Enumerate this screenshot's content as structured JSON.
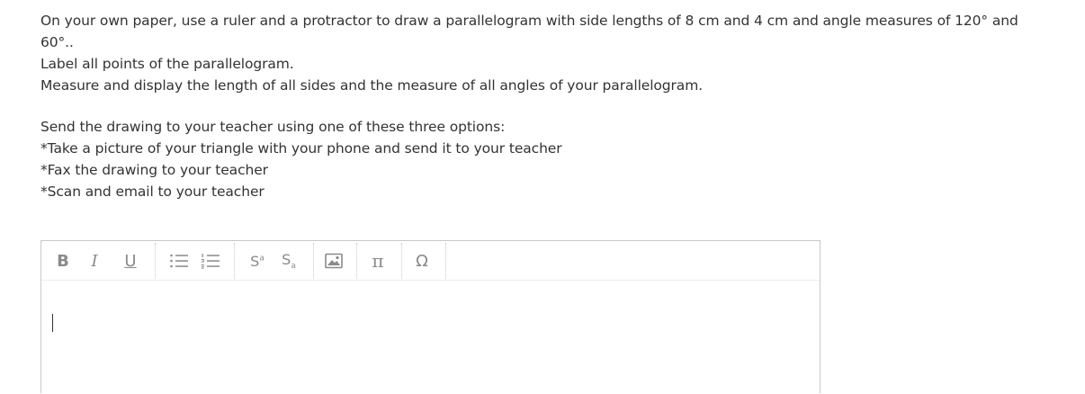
{
  "question": {
    "line1": "On your own paper, use a ruler and a protractor to draw a parallelogram with side lengths of 8 cm and 4 cm and angle measures of 120° and",
    "line1b": "60°..",
    "line2": "Label all points of the parallelogram.",
    "line3": "Measure and display the length of all sides and the measure of all angles of your parallelogram.",
    "line4": "Send the drawing to your teacher using one of these three options:",
    "line5": "*Take a picture of your triangle with your phone and send it to your teacher",
    "line6": "*Fax the drawing to your teacher",
    "line7": "*Scan and email to your teacher"
  },
  "toolbar": {
    "bold": "B",
    "italic": "I",
    "underline": "U",
    "superscript_base": "S",
    "superscript_mark": "a",
    "subscript_base": "S",
    "subscript_mark": "a",
    "pi": "π",
    "omega": "Ω",
    "icons": {
      "bullet_list": "bulleted-list-icon",
      "numbered_list": "numbered-list-icon",
      "image": "insert-image-icon"
    }
  },
  "editor": {
    "value": ""
  },
  "colors": {
    "text": "#333333",
    "toolbar_icon": "#8a8a8a",
    "border": "#c8c8c8"
  }
}
